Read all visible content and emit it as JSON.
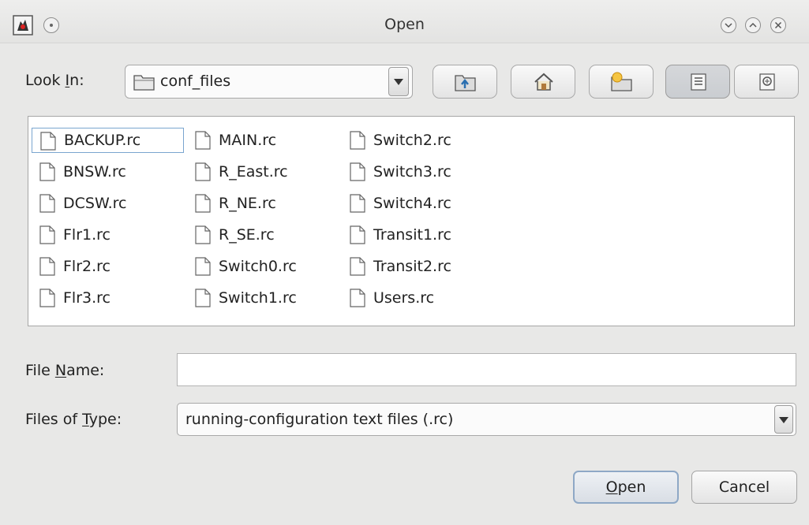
{
  "window": {
    "title": "Open",
    "app_icon": "java-duke-icon"
  },
  "look_in": {
    "label_prefix": "Look ",
    "label_mnemonic": "I",
    "label_suffix": "n:",
    "value": "conf_files",
    "value_icon": "folder-icon"
  },
  "toolbar": {
    "buttons": [
      {
        "name": "up-one-level",
        "icon": "folder-up-icon"
      },
      {
        "name": "home",
        "icon": "home-icon"
      },
      {
        "name": "new-folder",
        "icon": "new-folder-icon"
      },
      {
        "name": "list-view",
        "icon": "list-view-icon",
        "active": true
      },
      {
        "name": "details-view",
        "icon": "details-view-icon",
        "active": false
      }
    ]
  },
  "files": {
    "columns": [
      [
        "BACKUP.rc",
        "BNSW.rc",
        "DCSW.rc",
        "Flr1.rc",
        "Flr2.rc",
        "Flr3.rc"
      ],
      [
        "MAIN.rc",
        "R_East.rc",
        "R_NE.rc",
        "R_SE.rc",
        "Switch0.rc",
        "Switch1.rc"
      ],
      [
        "Switch2.rc",
        "Switch3.rc",
        "Switch4.rc",
        "Transit1.rc",
        "Transit2.rc",
        "Users.rc"
      ]
    ],
    "selected": "BACKUP.rc"
  },
  "file_name": {
    "label_prefix": "File ",
    "label_mnemonic": "N",
    "label_suffix": "ame:",
    "value": "",
    "placeholder": ""
  },
  "files_of_type": {
    "label_prefix": "Files of ",
    "label_mnemonic": "T",
    "label_suffix": "ype:",
    "value": "running-configuration text files (.rc)"
  },
  "buttons": {
    "open_mnemonic": "O",
    "open_rest": "pen",
    "cancel": "Cancel"
  },
  "colors": {
    "background": "#e8e8e7",
    "selection_border": "#7aa5cf",
    "default_button_border": "#8ea8c6"
  }
}
